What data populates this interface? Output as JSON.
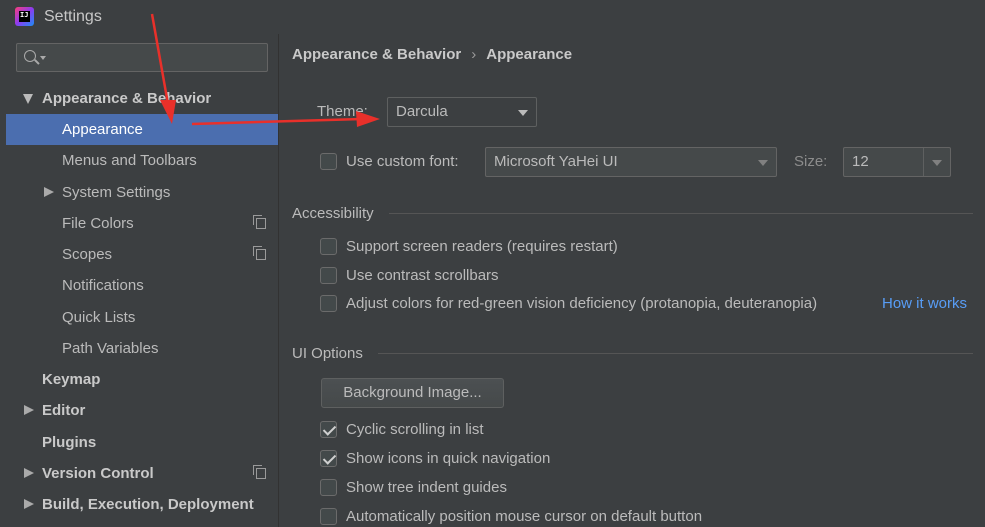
{
  "window": {
    "title": "Settings"
  },
  "sidebar": {
    "search": {
      "placeholder": ""
    },
    "items": [
      {
        "label": "Appearance & Behavior",
        "level": 0,
        "expanded": true,
        "bold": true
      },
      {
        "label": "Appearance",
        "level": 1,
        "selected": true
      },
      {
        "label": "Menus and Toolbars",
        "level": 1
      },
      {
        "label": "System Settings",
        "level": 1,
        "collapsed": true
      },
      {
        "label": "File Colors",
        "level": 1,
        "project_icon": true
      },
      {
        "label": "Scopes",
        "level": 1,
        "project_icon": true
      },
      {
        "label": "Notifications",
        "level": 1
      },
      {
        "label": "Quick Lists",
        "level": 1
      },
      {
        "label": "Path Variables",
        "level": 1
      },
      {
        "label": "Keymap",
        "level": 0,
        "bold": true
      },
      {
        "label": "Editor",
        "level": 0,
        "collapsed": true,
        "bold": true
      },
      {
        "label": "Plugins",
        "level": 0,
        "bold": true
      },
      {
        "label": "Version Control",
        "level": 0,
        "collapsed": true,
        "bold": true,
        "project_icon": true
      },
      {
        "label": "Build, Execution, Deployment",
        "level": 0,
        "collapsed": true,
        "bold": true
      }
    ]
  },
  "breadcrumb": {
    "parent": "Appearance & Behavior",
    "separator": "›",
    "current": "Appearance"
  },
  "theme": {
    "label": "Theme:",
    "value": "Darcula"
  },
  "font": {
    "checkbox_label": "Use custom font:",
    "checked": false,
    "value": "Microsoft YaHei UI",
    "size_label": "Size:",
    "size_value": "12"
  },
  "accessibility": {
    "title": "Accessibility",
    "options": [
      {
        "label": "Support screen readers (requires restart)",
        "checked": false
      },
      {
        "label": "Use contrast scrollbars",
        "checked": false
      },
      {
        "label": "Adjust colors for red-green vision deficiency (protanopia, deuteranopia)",
        "checked": false
      }
    ],
    "link": "How it works"
  },
  "ui_options": {
    "title": "UI Options",
    "button": "Background Image...",
    "options": [
      {
        "label": "Cyclic scrolling in list",
        "checked": true
      },
      {
        "label": "Show icons in quick navigation",
        "checked": true
      },
      {
        "label": "Show tree indent guides",
        "checked": false
      },
      {
        "label": "Automatically position mouse cursor on default button",
        "checked": false
      }
    ]
  },
  "colors": {
    "background": "#3c3f41",
    "selection": "#4b6eaf",
    "link": "#589df6",
    "annotation_arrow": "#e8302a"
  }
}
